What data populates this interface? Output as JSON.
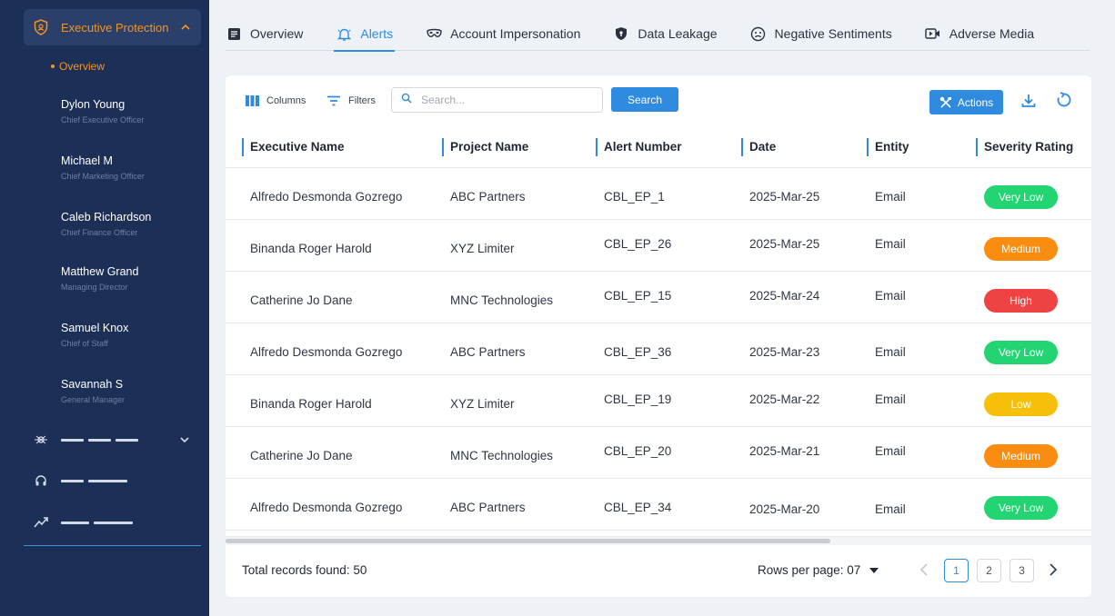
{
  "sidebar": {
    "section_title": "Executive Protection",
    "overview_label": "Overview",
    "people": [
      {
        "name": "Dylon Young",
        "role": "Chief Executive Officer"
      },
      {
        "name": "Michael M",
        "role": "Chief Marketing Officer"
      },
      {
        "name": "Caleb Richardson",
        "role": "Chief Finance Officer"
      },
      {
        "name": "Matthew Grand",
        "role": "Managing Director"
      },
      {
        "name": "Samuel Knox",
        "role": "Chief of Staff"
      },
      {
        "name": "Savannah S",
        "role": "General Manager"
      }
    ],
    "nav_icons": [
      "radar-icon",
      "headset-icon",
      "trending-icon"
    ]
  },
  "tabs": [
    {
      "label": "Overview",
      "icon": "document-icon"
    },
    {
      "label": "Alerts",
      "icon": "bell-icon",
      "active": true
    },
    {
      "label": "Account Impersonation",
      "icon": "mask-icon"
    },
    {
      "label": "Data Leakage",
      "icon": "shield-icon"
    },
    {
      "label": "Negative Sentiments",
      "icon": "sad-face-icon"
    },
    {
      "label": "Adverse Media",
      "icon": "video-icon"
    }
  ],
  "toolbar": {
    "columns_label": "Columns",
    "filters_label": "Filters",
    "search_placeholder": "Search...",
    "search_value": "",
    "search_button": "Search",
    "actions_label": "Actions"
  },
  "table": {
    "headers": [
      "Executive Name",
      "Project Name",
      "Alert Number",
      "Date",
      "Entity",
      "Severity Rating"
    ],
    "rows": [
      {
        "executive": "Alfredo Desmonda Gozrego",
        "project": "ABC Partners",
        "alert": "CBL_EP_1",
        "date": "2025-Mar-25",
        "entity": "Email",
        "severity": "Very Low"
      },
      {
        "executive": "Binanda Roger Harold",
        "project": "XYZ Limiter",
        "alert": "CBL_EP_26",
        "date": "2025-Mar-25",
        "entity": "Email",
        "severity": "Medium"
      },
      {
        "executive": "Catherine Jo Dane",
        "project": "MNC Technologies",
        "alert": "CBL_EP_15",
        "date": "2025-Mar-24",
        "entity": "Email",
        "severity": "High"
      },
      {
        "executive": "Alfredo Desmonda Gozrego",
        "project": "ABC Partners",
        "alert": "CBL_EP_36",
        "date": "2025-Mar-23",
        "entity": "Email",
        "severity": "Very Low"
      },
      {
        "executive": "Binanda Roger Harold",
        "project": "XYZ Limiter",
        "alert": "CBL_EP_19",
        "date": "2025-Mar-22",
        "entity": "Email",
        "severity": "Low"
      },
      {
        "executive": "Catherine Jo Dane",
        "project": "MNC Technologies",
        "alert": "CBL_EP_20",
        "date": "2025-Mar-21",
        "entity": "Email",
        "severity": "Medium"
      },
      {
        "executive": "Alfredo Desmonda Gozrego",
        "project": "ABC Partners",
        "alert": "CBL_EP_34",
        "date": "2025-Mar-20",
        "entity": "Email",
        "severity": "Very Low"
      }
    ]
  },
  "severity_colors": {
    "Very Low": "#22d472",
    "Medium": "#fa8c0f",
    "High": "#ef4343",
    "Low": "#f6bf0a"
  },
  "footer": {
    "total_label": "Total records found: 50",
    "rows_per_page_label": "Rows per page: 07",
    "pages": [
      "1",
      "2",
      "3"
    ],
    "current_page": "1"
  },
  "colors": {
    "sidebar_bg": "#1c2f57",
    "accent": "#2f8be0",
    "highlight": "#f7941d"
  }
}
